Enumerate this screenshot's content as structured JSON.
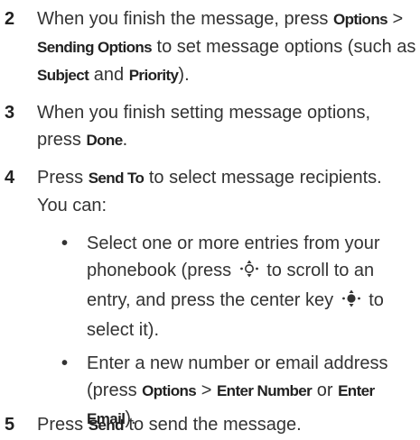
{
  "steps": [
    {
      "number": "2",
      "text_a": "When you finish the message, press ",
      "key_a": "Options",
      "sep_a": " > ",
      "key_b": "Sending Options",
      "text_b": " to set message options (such as ",
      "key_c": "Subject",
      "text_c": " and ",
      "key_d": "Priority",
      "text_d": ")."
    },
    {
      "number": "3",
      "text_a": "When you finish setting message options, press ",
      "key_a": "Done",
      "text_b": "."
    },
    {
      "number": "4",
      "text_a": "Press ",
      "key_a": "Send To",
      "text_b": " to select message recipients. You can:"
    },
    {
      "number": "5",
      "text_a": "Press ",
      "key_a": "Send",
      "text_b": " to send the message."
    }
  ],
  "bullets": [
    {
      "symbol": "•",
      "text_a": "Select one or more entries from your phonebook (press ",
      "icon_a": "nav-scroll-icon",
      "text_b": " to scroll to an entry, and press the center key ",
      "icon_b": "nav-center-select-icon",
      "text_c": " to select it)."
    },
    {
      "symbol": "•",
      "text_a": "Enter a new number or email address (press ",
      "key_a": "Options",
      "sep_a": " > ",
      "key_b": "Enter Number",
      "text_b": " or ",
      "key_c": "Enter Email",
      "text_c": ")."
    }
  ]
}
